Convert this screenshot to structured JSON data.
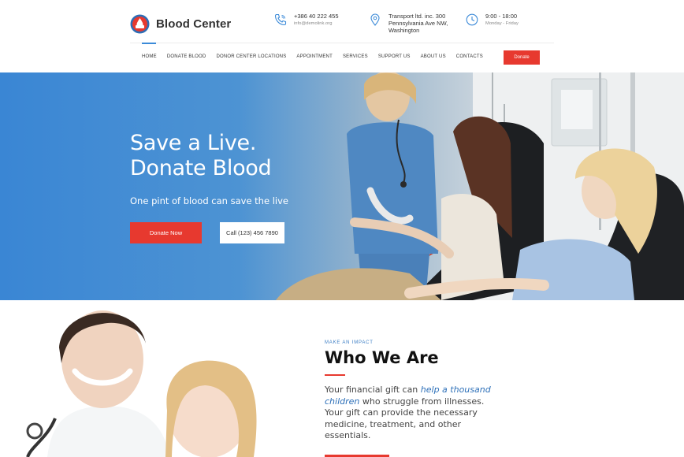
{
  "brand": {
    "name": "Blood Center"
  },
  "contacts": {
    "phone": {
      "number": "+386 40 222 455",
      "email": "info@demolink.org",
      "icon": "phone-icon"
    },
    "address": {
      "line1": "Transport ltd. inc. 300",
      "line2": "Pennsylvania Ave NW,",
      "line3": "Washington",
      "icon": "location-pin-icon"
    },
    "hours": {
      "time": "9:00 - 18:00",
      "days": "Monday - Friday",
      "icon": "clock-icon"
    }
  },
  "nav": {
    "items": [
      "Home",
      "Donate Blood",
      "Donor Center Locations",
      "Appointment",
      "Services",
      "Support Us",
      "About Us",
      "Contacts"
    ],
    "active": "Home",
    "cta": "Donate"
  },
  "hero": {
    "title_line1": "Save a Live.",
    "title_line2": "Donate Blood",
    "subtitle": "One pint of blood can save the live",
    "primary_button": "Donate Now",
    "secondary_button": "Call (123) 456 7890"
  },
  "about": {
    "kicker": "Make an Impact",
    "title": "Who We Are",
    "text_before": "Your financial gift can ",
    "text_highlight": "help a thousand children",
    "text_after": " who struggle from illnesses. Your gift can provide the necessary medicine, treatment, and other essentials."
  },
  "colors": {
    "accent": "#e7392f",
    "brand_blue": "#3a86d4",
    "link_blue": "#2c6fb8"
  }
}
